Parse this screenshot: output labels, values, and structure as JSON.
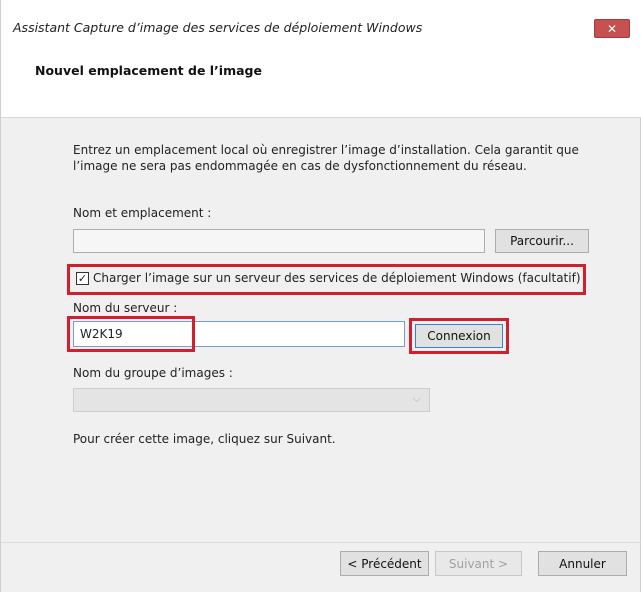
{
  "window": {
    "title": "Assistant Capture d’image des services de déploiement Windows",
    "close_label": "✕"
  },
  "header": {
    "title": "Nouvel emplacement de l’image"
  },
  "main": {
    "intro_line1": "Entrez un emplacement local où enregistrer l’image d’installation. Cela garantit que",
    "intro_line2": "l’image ne sera pas endommagée en cas de dysfonctionnement du réseau.",
    "name_location_label": "Nom et emplacement :",
    "name_location_value": "",
    "browse_label": "Parcourir...",
    "upload_checkbox_label": "Charger l’image sur un serveur des services de déploiement Windows (facultatif)",
    "upload_checked": true,
    "server_name_label": "Nom du serveur :",
    "server_name_value": "W2K19",
    "connect_label": "Connexion",
    "image_group_label": "Nom du groupe d’images :",
    "image_group_value": "",
    "instruction": "Pour créer cette image, cliquez sur Suivant."
  },
  "footer": {
    "previous_label": "< Précédent",
    "next_label": "Suivant >",
    "cancel_label": "Annuler"
  },
  "colors": {
    "highlight": "#d0202e",
    "close_button": "#c75050",
    "dialog_background": "#f0f0f0"
  }
}
